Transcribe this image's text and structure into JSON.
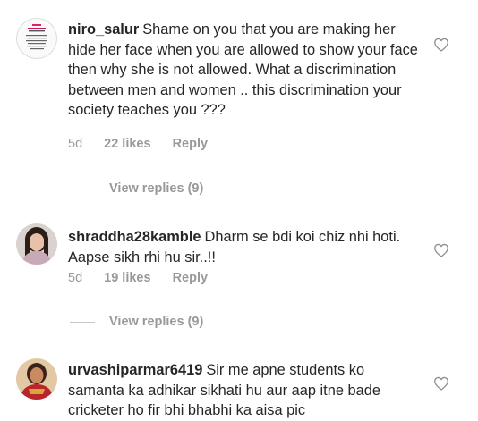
{
  "comments": [
    {
      "username": "niro_salur",
      "text": "Shame on you that you are making her hide her face when you are allowed to show your face then why she is not allowed. What a discrimination between men and women .. this discrimination your society teaches you ???",
      "time": "5d",
      "likes": "22 likes",
      "reply": "Reply",
      "view_replies": "View replies (9)",
      "avatar_icon": "poster-avatar"
    },
    {
      "username": "shraddha28kamble",
      "text": "Dharm se bdi koi chiz nhi hoti. Aapse sikh rhi hu sir..!!",
      "time": "5d",
      "likes": "19 likes",
      "reply": "Reply",
      "view_replies": "View replies (9)",
      "avatar_icon": "user-photo-avatar"
    },
    {
      "username": "urvashiparmar6419",
      "text": "Sir me apne students ko samanta ka adhikar sikhati hu aur aap itne bade cricketer ho fir bhi bhabhi ka aisa pic",
      "avatar_icon": "user-photo-avatar"
    }
  ],
  "colors": {
    "text": "#262626",
    "meta": "#999999",
    "divider": "#c7c7c7"
  },
  "icons": {
    "like": "heart-outline-icon"
  }
}
